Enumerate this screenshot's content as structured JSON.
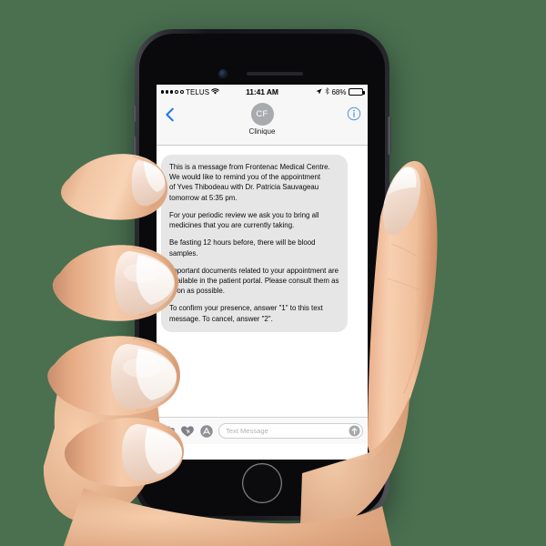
{
  "scene": {
    "background_color": "#4a7050",
    "description": "hand-holding-iphone-sms-mockup"
  },
  "device": {
    "frame_color": "#1b1c20",
    "screen_background": "#ffffff",
    "home_button": "home-button"
  },
  "status_bar": {
    "signal_dots_filled": 3,
    "signal_dots_hollow": 2,
    "carrier": "TELUS",
    "wifi_icon": "wifi-icon",
    "time": "11:41 AM",
    "location_icon": "location-arrow-icon",
    "bluetooth_icon": "bluetooth-icon",
    "battery_percent": "68%",
    "battery_level": 68
  },
  "nav_bar": {
    "back_icon": "chevron-left-icon",
    "avatar_initials": "CF",
    "contact_name": "Clinique",
    "info_icon": "info-circle-icon",
    "accent_color": "#1a7ae8"
  },
  "conversation": {
    "bubble_color": "#e6e6e6",
    "text_color": "#0a0a0a",
    "message_paragraphs": [
      "This is a message from Frontenac Medical Centre. We would like to remind you of the appointment\nof Yves Thibodeau with Dr. Patricia Sauvageau tomorrow at 5:35 pm.",
      "For your periodic review we ask you to bring all medicines that you are currently taking.",
      "Be fasting 12 hours before, there will be blood samples.",
      "Important documents related to your appointment are available in the patient portal. Please consult them as soon as possible.",
      "To confirm your presence, answer \"1\" to this text message. To cancel, answer \"2\"."
    ]
  },
  "toolbar": {
    "camera_icon": "camera-icon",
    "digital_touch_icon": "heart-hand-icon",
    "app_store_icon": "app-store-a-icon",
    "placeholder": "Text Message",
    "send_icon": "send-arrow-up-icon",
    "send_enabled": false
  }
}
